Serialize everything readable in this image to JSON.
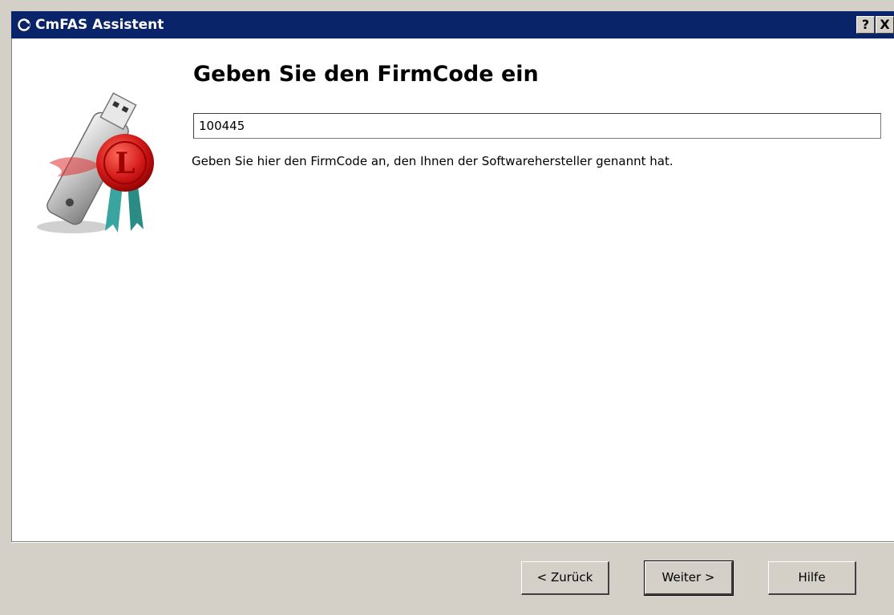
{
  "window": {
    "title": "CmFAS Assistent",
    "help_button": "?",
    "close_button": "X"
  },
  "page": {
    "heading": "Geben Sie den FirmCode ein",
    "firmcode_value": "100445",
    "hint": "Geben Sie hier den FirmCode an, den Ihnen der Softwarehersteller genannt hat."
  },
  "buttons": {
    "back": "< Zurück",
    "next": "Weiter >",
    "help": "Hilfe"
  },
  "colors": {
    "titlebar": "#0a246a",
    "dialog_bg": "#d4d0c8",
    "content_bg": "#ffffff",
    "seal_red": "#d01818"
  },
  "icons": {
    "title": "cmfas-app-icon",
    "logo": "usb-dongle-wax-seal-icon"
  }
}
